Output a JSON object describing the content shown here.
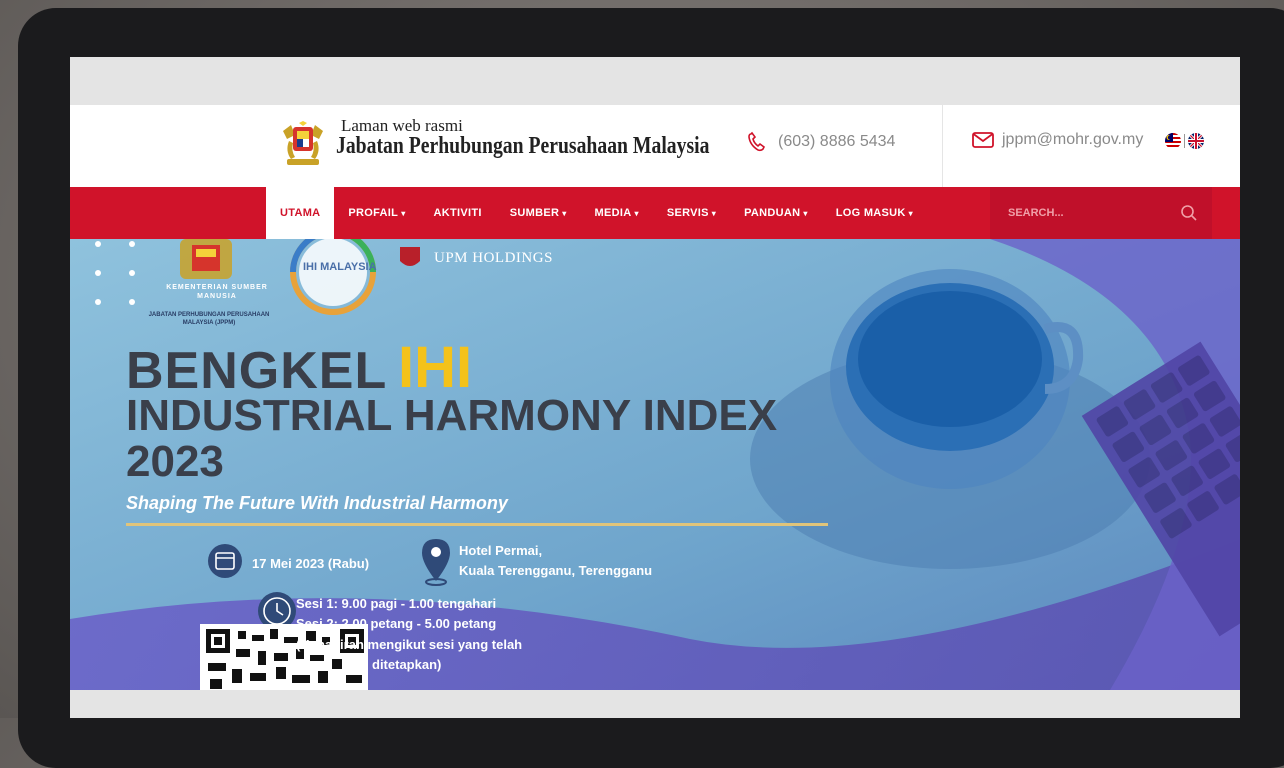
{
  "header": {
    "subtitle": "Laman web rasmi",
    "title": "Jabatan Perhubungan Perusahaan Malaysia",
    "phone": "(603) 8886 5434",
    "email": "jppm@mohr.gov.my"
  },
  "nav": {
    "items": [
      {
        "label": "UTAMA",
        "dropdown": false
      },
      {
        "label": "PROFAIL",
        "dropdown": true
      },
      {
        "label": "AKTIVITI",
        "dropdown": false
      },
      {
        "label": "SUMBER",
        "dropdown": true
      },
      {
        "label": "MEDIA",
        "dropdown": true
      },
      {
        "label": "SERVIS",
        "dropdown": true
      },
      {
        "label": "PANDUAN",
        "dropdown": true
      },
      {
        "label": "LOG MASUK",
        "dropdown": true
      }
    ],
    "active_index": 0,
    "search_placeholder": "SEARCH..."
  },
  "banner": {
    "ministry_logo_text": "KEMENTERIAN SUMBER MANUSIA",
    "department_text": "JABATAN PERHUBUNGAN PERUSAHAAN MALAYSIA (JPPM)",
    "ihi_logo_text": "IHI MALAYSIA",
    "upm_logo_text": "UPM HOLDINGS",
    "headline_1": "BENGKEL",
    "headline_ihi": "IHI",
    "headline_2": "INDUSTRIAL HARMONY INDEX",
    "headline_year": "2023",
    "tagline": "Shaping The Future With Industrial Harmony",
    "date": "17 Mei 2023 (Rabu)",
    "location_1": "Hotel Permai,",
    "location_2": "Kuala Terengganu, Terengganu",
    "session_1": "Sesi 1: 9.00 pagi - 1.00 tengahari",
    "session_2": "Sesi 2: 2.00 petang - 5.00 petang",
    "note_1": "(Kehadiran mengikut sesi yang telah",
    "note_2": "ditetapkan)"
  },
  "colors": {
    "brand_red": "#d0132a",
    "headline_gold": "#f4c21a",
    "headline_dark": "#3a3f4a"
  }
}
